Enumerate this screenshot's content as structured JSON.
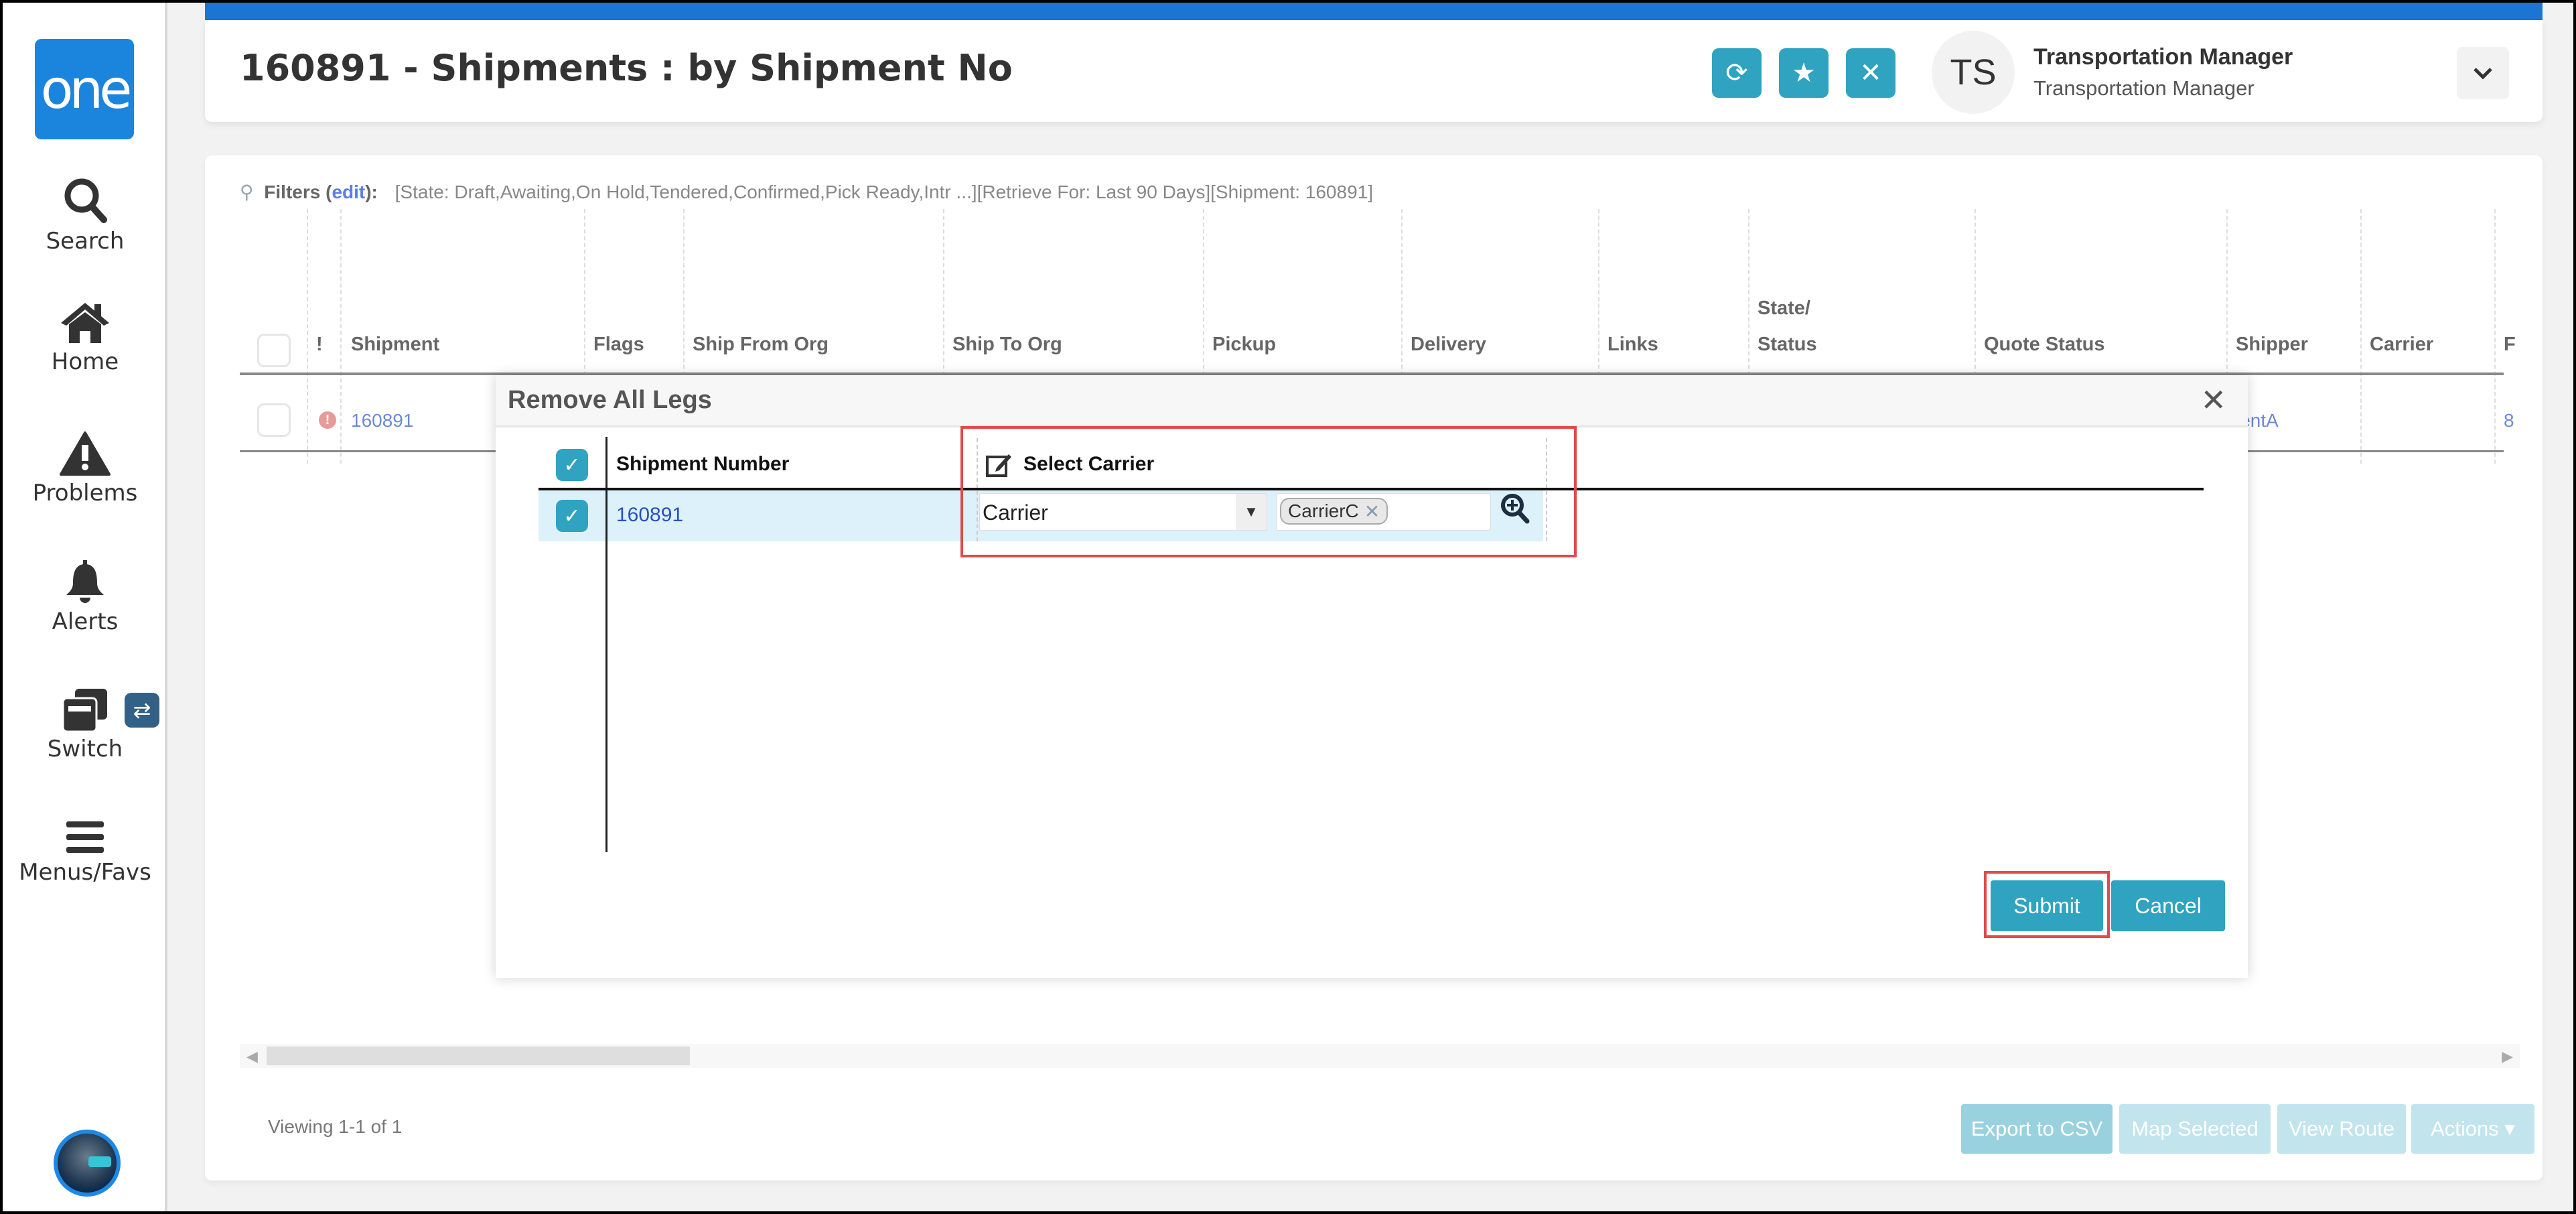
{
  "sidebar": {
    "logo": "one",
    "items": [
      {
        "label": "Search",
        "icon": "search-icon"
      },
      {
        "label": "Home",
        "icon": "home-icon"
      },
      {
        "label": "Problems",
        "icon": "warning-icon"
      },
      {
        "label": "Alerts",
        "icon": "bell-icon"
      },
      {
        "label": "Switch",
        "icon": "windows-icon"
      },
      {
        "label": "Menus/Favs",
        "icon": "hamburger-icon"
      }
    ],
    "switch_badge": "⇄"
  },
  "header": {
    "title": "160891 - Shipments : by Shipment No",
    "buttons": {
      "refresh": "⟳",
      "favorite": "★",
      "close": "✕"
    },
    "user": {
      "initials": "TS",
      "name": "Transportation Manager",
      "role": "Transportation Manager"
    },
    "menu_chevron": "⌄"
  },
  "filters": {
    "label": "Filters",
    "edit": "edit",
    "text": "[State: Draft,Awaiting,On Hold,Tendered,Confirmed,Pick Ready,Intr ...][Retrieve For: Last 90 Days][Shipment: 160891]"
  },
  "grid": {
    "columns": [
      "!",
      "Shipment",
      "Flags",
      "Ship From Org",
      "Ship To Org",
      "Pickup",
      "Delivery",
      "Links",
      "State/",
      "Status",
      "Quote Status",
      "Shipper",
      "Carrier",
      "F"
    ],
    "rows": [
      {
        "shipment": "160891",
        "shipper": "ientA",
        "last": "8"
      }
    ]
  },
  "footer": {
    "viewing": "Viewing 1-1 of 1",
    "buttons": [
      "Export to CSV",
      "Map Selected",
      "View Route",
      "Actions ▾"
    ]
  },
  "modal": {
    "title": "Remove All Legs",
    "close": "✕",
    "columns": {
      "shipment_number": "Shipment Number",
      "select_carrier": "Select Carrier"
    },
    "row": {
      "shipment_number": "160891",
      "carrier_type": "Carrier",
      "carrier_tag": "CarrierC"
    },
    "submit": "Submit",
    "cancel": "Cancel"
  },
  "colors": {
    "brand": "#1b84dc",
    "accent": "#2fa3c0",
    "highlight": "#e04a4a"
  }
}
